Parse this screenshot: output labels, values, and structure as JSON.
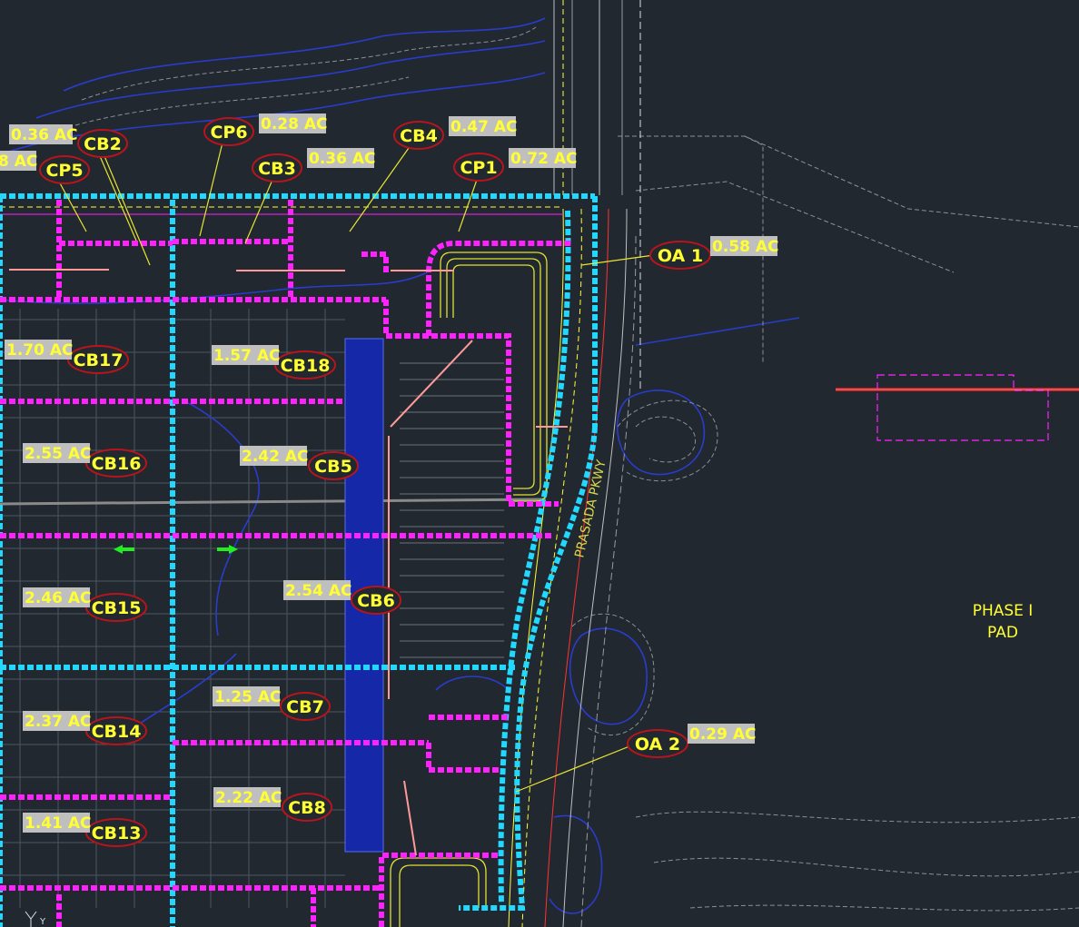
{
  "colors": {
    "background": "#212830",
    "basin_boundary": "#ff22ff",
    "major_boundary": "#22d8ff",
    "label_text": "#ffff33",
    "label_oval": "#b8141c",
    "area_box": "#bfbfbf",
    "contour": "#2a3ccc",
    "grid": "#5c6670"
  },
  "basins": [
    {
      "id": "cb2",
      "name": "CB2"
    },
    {
      "id": "cp6",
      "name": "CP6",
      "area": "0.28 AC"
    },
    {
      "id": "cb4",
      "name": "CB4",
      "area": "0.47 AC"
    },
    {
      "id": "cp5",
      "name": "CP5"
    },
    {
      "id": "cb3",
      "name": "CB3",
      "area": "0.36 AC"
    },
    {
      "id": "cp1",
      "name": "CP1",
      "area": "0.72 AC"
    },
    {
      "id": "oa1",
      "name": "OA 1",
      "area": "0.58 AC"
    },
    {
      "id": "cb17",
      "name": "CB17",
      "area": "1.70 AC"
    },
    {
      "id": "cb18",
      "name": "CB18",
      "area": "1.57 AC"
    },
    {
      "id": "cb16",
      "name": "CB16",
      "area": "2.55 AC"
    },
    {
      "id": "cb5",
      "name": "CB5",
      "area": "2.42 AC"
    },
    {
      "id": "cb15",
      "name": "CB15",
      "area": "2.46 AC"
    },
    {
      "id": "cb6",
      "name": "CB6",
      "area": "2.54 AC"
    },
    {
      "id": "cb7",
      "name": "CB7",
      "area": "1.25 AC"
    },
    {
      "id": "cb14",
      "name": "CB14",
      "area": "2.37 AC"
    },
    {
      "id": "oa2",
      "name": "OA 2",
      "area": "0.29 AC"
    },
    {
      "id": "cb8",
      "name": "CB8",
      "area": "2.22 AC"
    },
    {
      "id": "cb13",
      "name": "CB13",
      "area": "1.41 AC"
    }
  ],
  "partial_area_labels": [
    "0.36 AC",
    "8 AC"
  ],
  "road_name": "PRASADA PKWY",
  "pad_label": {
    "line1": "PHASE I",
    "line2": "PAD"
  },
  "ucs_icon": "Y"
}
